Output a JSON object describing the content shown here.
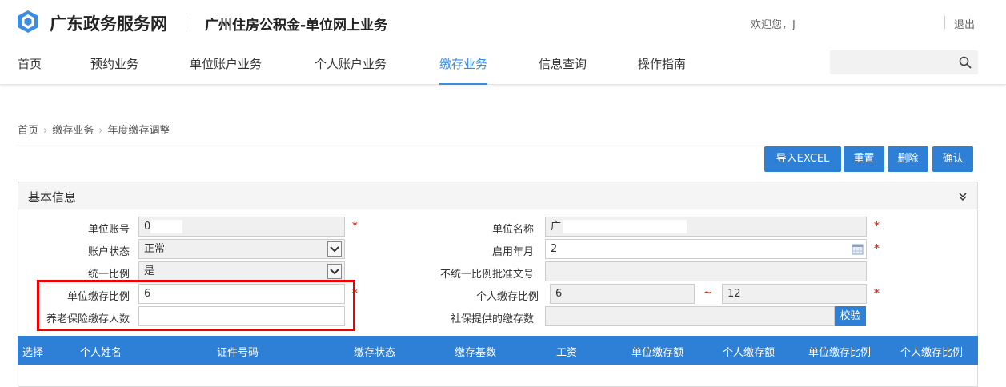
{
  "header": {
    "site_title": "广东政务服务网",
    "system_title": "广州住房公积金-单位网上业务",
    "welcome": "欢迎您，J",
    "logout": "退出"
  },
  "nav": {
    "items": [
      "首页",
      "预约业务",
      "单位账户业务",
      "个人账户业务",
      "缴存业务",
      "信息查询",
      "操作指南"
    ],
    "active": "缴存业务",
    "search_placeholder": ""
  },
  "breadcrumb": [
    "首页",
    "缴存业务",
    "年度缴存调整"
  ],
  "toolbar": {
    "import_excel": "导入EXCEL",
    "reset": "重置",
    "delete": "删除",
    "confirm": "确认"
  },
  "panel": {
    "title": "基本信息",
    "fields": {
      "unit_account_label": "单位账号",
      "unit_account_value": "0",
      "unit_name_label": "单位名称",
      "unit_name_value": "广",
      "account_status_label": "账户状态",
      "account_status_value": "正常",
      "start_month_label": "启用年月",
      "start_month_value": "2",
      "unified_ratio_label": "统一比例",
      "unified_ratio_value": "是",
      "nonunified_doc_label": "不统一比例批准文号",
      "nonunified_doc_value": "",
      "unit_ratio_label": "单位缴存比例",
      "unit_ratio_value": "6",
      "personal_ratio_label": "个人缴存比例",
      "personal_ratio_min": "6",
      "personal_ratio_max": "12",
      "range_sep": "~",
      "pension_count_label": "养老保险缴存人数",
      "pension_count_value": "",
      "social_sec_label": "社保提供的缴存数",
      "social_sec_value": "",
      "check_button": "校验"
    },
    "required_mark": "*"
  },
  "table": {
    "headers": [
      "选择",
      "个人姓名",
      "证件号码",
      "缴存状态",
      "缴存基数",
      "工资",
      "单位缴存额",
      "个人缴存额",
      "单位缴存比例",
      "个人缴存比例"
    ]
  },
  "colors": {
    "accent": "#2e7fd6",
    "nav_active": "#3a8de0",
    "required": "#e0301e",
    "highlight": "#e00000"
  }
}
